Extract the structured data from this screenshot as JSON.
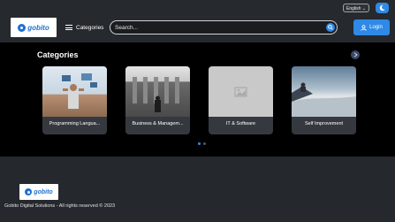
{
  "colors": {
    "accent": "#2f89e6",
    "page_bg": "#25282c",
    "main_bg": "#000000"
  },
  "header": {
    "language": {
      "selected": "English",
      "chevron_icon": "chevron-down-icon"
    },
    "theme_toggle_icon": "moon-icon",
    "logo_text": "gobito",
    "categories_label": "Categories",
    "search": {
      "placeholder": "Search...",
      "icon": "search-icon"
    },
    "login_label": "Login",
    "login_icon": "user-icon"
  },
  "categories": {
    "title": "Categories",
    "next_icon": "chevron-right-icon",
    "cards": [
      {
        "label": "Programming Langua..."
      },
      {
        "label": "Business & Managem..."
      },
      {
        "label": "IT & Software"
      },
      {
        "label": "Self Improvement"
      }
    ],
    "pagination": {
      "pages": 2,
      "active": 1
    }
  },
  "footer": {
    "logo_text": "gobito",
    "copyright": "Gobito Digital Solutions - All rights reserved © 2023"
  }
}
